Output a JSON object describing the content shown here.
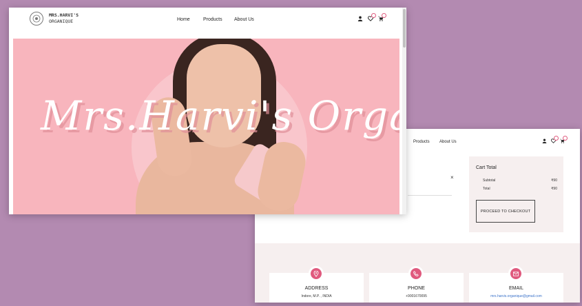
{
  "front": {
    "logo": {
      "line1": "MRS.HARVI'S",
      "line2": "ORGANIQUE"
    },
    "nav": {
      "home": "Home",
      "products": "Products",
      "about": "About Us"
    },
    "hero": {
      "brand_text": "Mrs.Harvi's Organique"
    }
  },
  "back": {
    "nav": {
      "products": "Products",
      "about": "About Us"
    },
    "remove_symbol": "×",
    "cart": {
      "title": "Cart Total",
      "subtotal_label": "Subtotal",
      "subtotal_value": "₹90",
      "total_label": "Total",
      "total_value": "₹90",
      "checkout_label": "PROCEED TO CHECKOUT"
    },
    "contact": {
      "address_title": "ADDRESS",
      "address_value": "Indore, M.P. , INDIA",
      "phone_title": "PHONE",
      "phone_value": "+9001670095",
      "email_title": "EMAIL",
      "email_value": "mrs.harvis.organique@gmail.com"
    }
  },
  "colors": {
    "background": "#b38ab1",
    "accent": "#e05a7e",
    "hero": "#f8b5bd",
    "panel": "#f6efef"
  }
}
